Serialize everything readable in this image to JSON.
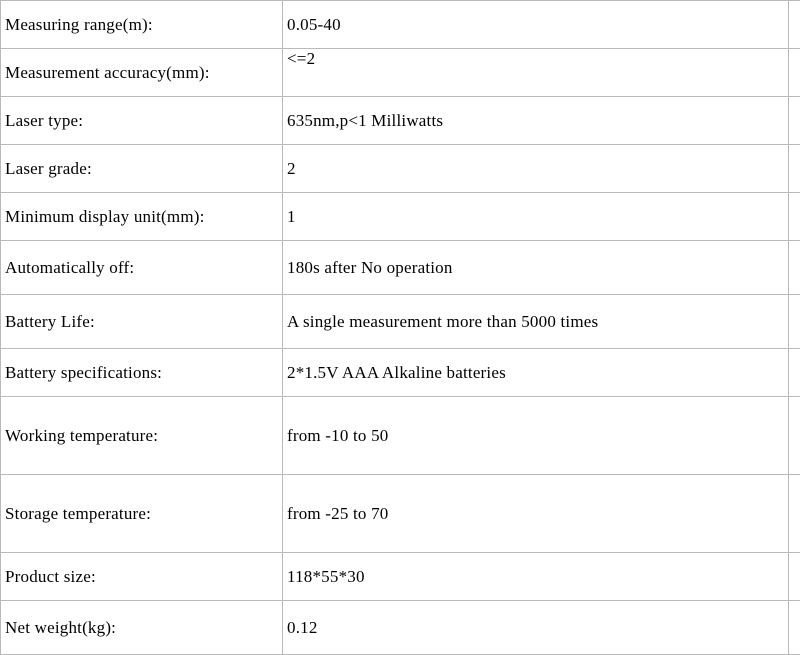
{
  "rows": [
    {
      "label": "Measuring range(m):",
      "value": "0.05-40"
    },
    {
      "label": "Measurement accuracy(mm):",
      "value": "<=2"
    },
    {
      "label": "Laser type:",
      "value": "635nm,p<1 Milliwatts"
    },
    {
      "label": "Laser grade:",
      "value": "2"
    },
    {
      "label": "Minimum display unit(mm):",
      "value": "1"
    },
    {
      "label": "Automatically off:",
      "value": "180s after No operation"
    },
    {
      "label": "Battery Life:",
      "value": "A single measurement more than 5000 times"
    },
    {
      "label": "Battery specifications:",
      "value": "2*1.5V AAA Alkaline batteries"
    },
    {
      "label": "Working temperature:",
      "value": "from -10 to 50"
    },
    {
      "label": "Storage temperature:",
      "value": "from -25 to 70"
    },
    {
      "label": "Product size:",
      "value": "118*55*30"
    },
    {
      "label": "Net weight(kg):",
      "value": "0.12"
    }
  ]
}
